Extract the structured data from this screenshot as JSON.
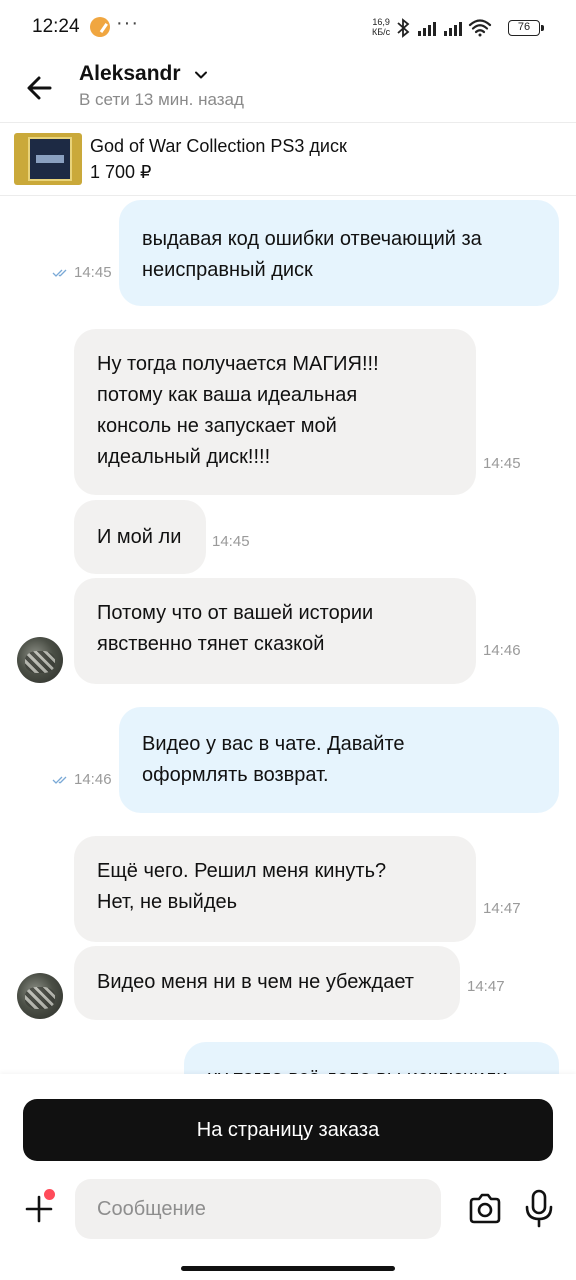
{
  "status_bar": {
    "time": "12:24",
    "dots": "···",
    "speed_value": "16,9",
    "speed_unit": "КБ/с",
    "battery": "76"
  },
  "header": {
    "contact_name": "Aleksandr",
    "contact_status": "В сети 13 мин. назад",
    "icons": [
      "arrow-left-icon",
      "chevron-down-icon"
    ]
  },
  "product": {
    "title": "God of War Collection PS3 диск",
    "price": "1 700 ₽"
  },
  "messages": [
    {
      "direction": "out",
      "lines": [
        "выдавая код ошибки отвечающий за",
        "неисправный диск"
      ],
      "time": "14:45",
      "read": true
    },
    {
      "direction": "in",
      "lines": [
        "Ну тогда получается МАГИЯ!!!",
        "потому как ваша идеальная",
        "консоль не запускает мой",
        "идеальный диск!!!!"
      ],
      "time": "14:45"
    },
    {
      "direction": "in",
      "lines": [
        "И мой ли"
      ],
      "time": "14:45"
    },
    {
      "direction": "in",
      "lines": [
        "Потому что от вашей истории",
        "явственно тянет сказкой"
      ],
      "time": "14:46",
      "avatar": true
    },
    {
      "direction": "out",
      "lines": [
        "Видео у вас в чате. Давайте",
        "оформлять возврат."
      ],
      "time": "14:46",
      "read": true
    },
    {
      "direction": "in",
      "lines": [
        "Ещё чего. Решил меня кинуть?",
        "Нет, не выйдеь"
      ],
      "time": "14:47"
    },
    {
      "direction": "in",
      "lines": [
        "Видео меня ни в чем не убеждает"
      ],
      "time": "14:47",
      "avatar": true
    },
    {
      "direction": "out",
      "lines": [
        "ну тогда всё дело вы исключили"
      ],
      "time": "",
      "partial": true
    }
  ],
  "bottom": {
    "order_button": "На страницу заказа",
    "message_placeholder": "Сообщение",
    "icons": [
      "plus-icon",
      "camera-icon",
      "microphone-icon"
    ]
  },
  "colors": {
    "outgoing_bubble": "#e6f4fd",
    "incoming_bubble": "#f2f1f0",
    "primary_button": "#111111",
    "notification_dot": "#ff4b5a",
    "read_ticks": "#7aa9d6"
  }
}
